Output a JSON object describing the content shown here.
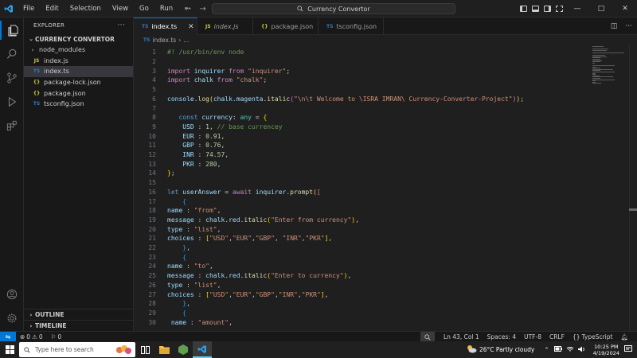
{
  "menu": [
    "File",
    "Edit",
    "Selection",
    "View",
    "Go",
    "Run",
    "···"
  ],
  "command_center": "Currency Convertor",
  "explorer": {
    "header": "EXPLORER",
    "folder": "CURRENCY CONVERTOR",
    "items": [
      {
        "label": "node_modules",
        "kind": "folder"
      },
      {
        "label": "index.js",
        "kind": "js",
        "badge": "JS"
      },
      {
        "label": "index.ts",
        "kind": "ts",
        "badge": "TS",
        "selected": true
      },
      {
        "label": "package-lock.json",
        "kind": "json",
        "badge": "{}"
      },
      {
        "label": "package.json",
        "kind": "json",
        "badge": "{}"
      },
      {
        "label": "tsconfig.json",
        "kind": "tsconfig",
        "badge": "TS"
      }
    ],
    "outline": "OUTLINE",
    "timeline": "TIMELINE"
  },
  "tabs": [
    {
      "label": "index.ts",
      "badge": "TS",
      "active": true
    },
    {
      "label": "index.js",
      "badge": "JS",
      "italic": true
    },
    {
      "label": "package.json",
      "badge": "{}"
    },
    {
      "label": "tsconfig.json",
      "badge": "TS"
    }
  ],
  "breadcrumb": {
    "file": "index.ts",
    "rest": "..."
  },
  "code_lines": [
    {
      "n": "1",
      "t": [
        [
          "cm",
          "#! /usr/bin/env node"
        ]
      ]
    },
    {
      "n": "2",
      "t": []
    },
    {
      "n": "3",
      "t": [
        [
          "kw",
          "import "
        ],
        [
          "id",
          "inquirer"
        ],
        [
          "kw",
          " from "
        ],
        [
          "str",
          "\"inquirer\""
        ],
        [
          "pl",
          ";"
        ]
      ]
    },
    {
      "n": "4",
      "t": [
        [
          "kw",
          "import "
        ],
        [
          "id",
          "chalk"
        ],
        [
          "kw",
          " from "
        ],
        [
          "str",
          "\"chalk\""
        ],
        [
          "pl",
          ";"
        ]
      ]
    },
    {
      "n": "5",
      "t": []
    },
    {
      "n": "6",
      "t": [
        [
          "id",
          "console"
        ],
        [
          "pl",
          "."
        ],
        [
          "fn",
          "log"
        ],
        [
          "br1",
          "("
        ],
        [
          "id",
          "chalk"
        ],
        [
          "pl",
          "."
        ],
        [
          "id",
          "magenta"
        ],
        [
          "pl",
          "."
        ],
        [
          "fn",
          "italic"
        ],
        [
          "br2",
          "("
        ],
        [
          "str",
          "\"\\n\\t Welcome to \\ISRA IMRAN\\ Currency-Converter-Project\""
        ],
        [
          "br2",
          ")"
        ],
        [
          "br1",
          ")"
        ],
        [
          "pl",
          ";"
        ]
      ]
    },
    {
      "n": "7",
      "t": []
    },
    {
      "n": "8",
      "t": [
        [
          "pl",
          "   "
        ],
        [
          "bl",
          "const "
        ],
        [
          "id",
          "currency"
        ],
        [
          "pl",
          ": "
        ],
        [
          "ty",
          "any"
        ],
        [
          "pl",
          " = "
        ],
        [
          "br1",
          "{"
        ]
      ]
    },
    {
      "n": "9",
      "t": [
        [
          "pl",
          "    "
        ],
        [
          "id",
          "USD"
        ],
        [
          "pl",
          " : "
        ],
        [
          "num",
          "1"
        ],
        [
          "pl",
          ", "
        ],
        [
          "cm",
          "// base currencey"
        ]
      ]
    },
    {
      "n": "10",
      "t": [
        [
          "pl",
          "    "
        ],
        [
          "id",
          "EUR"
        ],
        [
          "pl",
          " : "
        ],
        [
          "num",
          "0.91"
        ],
        [
          "pl",
          ","
        ]
      ]
    },
    {
      "n": "11",
      "t": [
        [
          "pl",
          "    "
        ],
        [
          "id",
          "GBP"
        ],
        [
          "pl",
          " : "
        ],
        [
          "num",
          "0.76"
        ],
        [
          "pl",
          ","
        ]
      ]
    },
    {
      "n": "12",
      "t": [
        [
          "pl",
          "    "
        ],
        [
          "id",
          "INR"
        ],
        [
          "pl",
          " : "
        ],
        [
          "num",
          "74.57"
        ],
        [
          "pl",
          ","
        ]
      ]
    },
    {
      "n": "13",
      "t": [
        [
          "pl",
          "    "
        ],
        [
          "id",
          "PKR"
        ],
        [
          "pl",
          " : "
        ],
        [
          "num",
          "280"
        ],
        [
          "pl",
          ","
        ]
      ]
    },
    {
      "n": "14",
      "t": [
        [
          "br1",
          "}"
        ],
        [
          "pl",
          ";"
        ]
      ]
    },
    {
      "n": "15",
      "t": []
    },
    {
      "n": "16",
      "t": [
        [
          "bl",
          "let "
        ],
        [
          "id",
          "userAnswer"
        ],
        [
          "pl",
          " = "
        ],
        [
          "kw",
          "await "
        ],
        [
          "id",
          "inquirer"
        ],
        [
          "pl",
          "."
        ],
        [
          "fn",
          "prompt"
        ],
        [
          "br1",
          "("
        ],
        [
          "br2",
          "["
        ]
      ]
    },
    {
      "n": "17",
      "t": [
        [
          "pl",
          "    "
        ],
        [
          "br3",
          "{"
        ]
      ]
    },
    {
      "n": "18",
      "t": [
        [
          "id",
          "name"
        ],
        [
          "pl",
          " : "
        ],
        [
          "str",
          "\"from\""
        ],
        [
          "pl",
          ","
        ]
      ]
    },
    {
      "n": "19",
      "t": [
        [
          "id",
          "message"
        ],
        [
          "pl",
          " : "
        ],
        [
          "id",
          "chalk"
        ],
        [
          "pl",
          "."
        ],
        [
          "id",
          "red"
        ],
        [
          "pl",
          "."
        ],
        [
          "fn",
          "italic"
        ],
        [
          "br1",
          "("
        ],
        [
          "str",
          "\"Enter from currency\""
        ],
        [
          "br1",
          ")"
        ],
        [
          "pl",
          ","
        ]
      ]
    },
    {
      "n": "20",
      "t": [
        [
          "id",
          "type"
        ],
        [
          "pl",
          " : "
        ],
        [
          "str",
          "\"list\""
        ],
        [
          "pl",
          ","
        ]
      ]
    },
    {
      "n": "21",
      "t": [
        [
          "id",
          "choices"
        ],
        [
          "pl",
          " : "
        ],
        [
          "br1",
          "["
        ],
        [
          "str",
          "\"USD\""
        ],
        [
          "pl",
          ","
        ],
        [
          "str",
          "\"EUR\""
        ],
        [
          "pl",
          ","
        ],
        [
          "str",
          "\"GBP\""
        ],
        [
          "pl",
          ", "
        ],
        [
          "str",
          "\"INR\""
        ],
        [
          "pl",
          ","
        ],
        [
          "str",
          "\"PKR\""
        ],
        [
          "br1",
          "]"
        ],
        [
          "pl",
          ","
        ]
      ]
    },
    {
      "n": "22",
      "t": [
        [
          "pl",
          "    "
        ],
        [
          "br3",
          "}"
        ],
        [
          "pl",
          ","
        ]
      ]
    },
    {
      "n": "23",
      "t": [
        [
          "pl",
          "    "
        ],
        [
          "br3",
          "{"
        ]
      ]
    },
    {
      "n": "24",
      "t": [
        [
          "id",
          "name"
        ],
        [
          "pl",
          " : "
        ],
        [
          "str",
          "\"to\""
        ],
        [
          "pl",
          ","
        ]
      ]
    },
    {
      "n": "25",
      "t": [
        [
          "id",
          "message"
        ],
        [
          "pl",
          " : "
        ],
        [
          "id",
          "chalk"
        ],
        [
          "pl",
          "."
        ],
        [
          "id",
          "red"
        ],
        [
          "pl",
          "."
        ],
        [
          "fn",
          "italic"
        ],
        [
          "br1",
          "("
        ],
        [
          "str",
          "\"Enter to currency\""
        ],
        [
          "br1",
          ")"
        ],
        [
          "pl",
          ","
        ]
      ]
    },
    {
      "n": "26",
      "t": [
        [
          "id",
          "type"
        ],
        [
          "pl",
          " : "
        ],
        [
          "str",
          "\"list\""
        ],
        [
          "pl",
          ","
        ]
      ]
    },
    {
      "n": "27",
      "t": [
        [
          "id",
          "choices"
        ],
        [
          "pl",
          " : "
        ],
        [
          "br1",
          "["
        ],
        [
          "str",
          "\"USD\""
        ],
        [
          "pl",
          ","
        ],
        [
          "str",
          "\"EUR\""
        ],
        [
          "pl",
          ","
        ],
        [
          "str",
          "\"GBP\""
        ],
        [
          "pl",
          ","
        ],
        [
          "str",
          "\"INR\""
        ],
        [
          "pl",
          ","
        ],
        [
          "str",
          "\"PKR\""
        ],
        [
          "br1",
          "]"
        ],
        [
          "pl",
          ","
        ]
      ]
    },
    {
      "n": "28",
      "t": [
        [
          "pl",
          "    "
        ],
        [
          "br3",
          "}"
        ],
        [
          "pl",
          ","
        ]
      ]
    },
    {
      "n": "29",
      "t": [
        [
          "pl",
          "    "
        ],
        [
          "br3",
          "{"
        ]
      ]
    },
    {
      "n": "30",
      "t": [
        [
          "pl",
          " "
        ],
        [
          "id",
          "name"
        ],
        [
          "pl",
          " : "
        ],
        [
          "str",
          "\"amount\""
        ],
        [
          "pl",
          ","
        ]
      ]
    }
  ],
  "status": {
    "errors": "0",
    "warnings": "0",
    "ports": "0",
    "position": "Ln 43, Col 1",
    "spaces": "Spaces: 4",
    "encoding": "UTF-8",
    "eol": "CRLF",
    "language": "TypeScript"
  },
  "taskbar": {
    "search_placeholder": "Type here to search",
    "weather": "26°C  Partly cloudy",
    "time": "10:25 PM",
    "date": "4/19/2024"
  },
  "colors": {
    "accent": "#0078d4",
    "editor_bg": "#1f1f1f",
    "sidebar_bg": "#181818"
  }
}
